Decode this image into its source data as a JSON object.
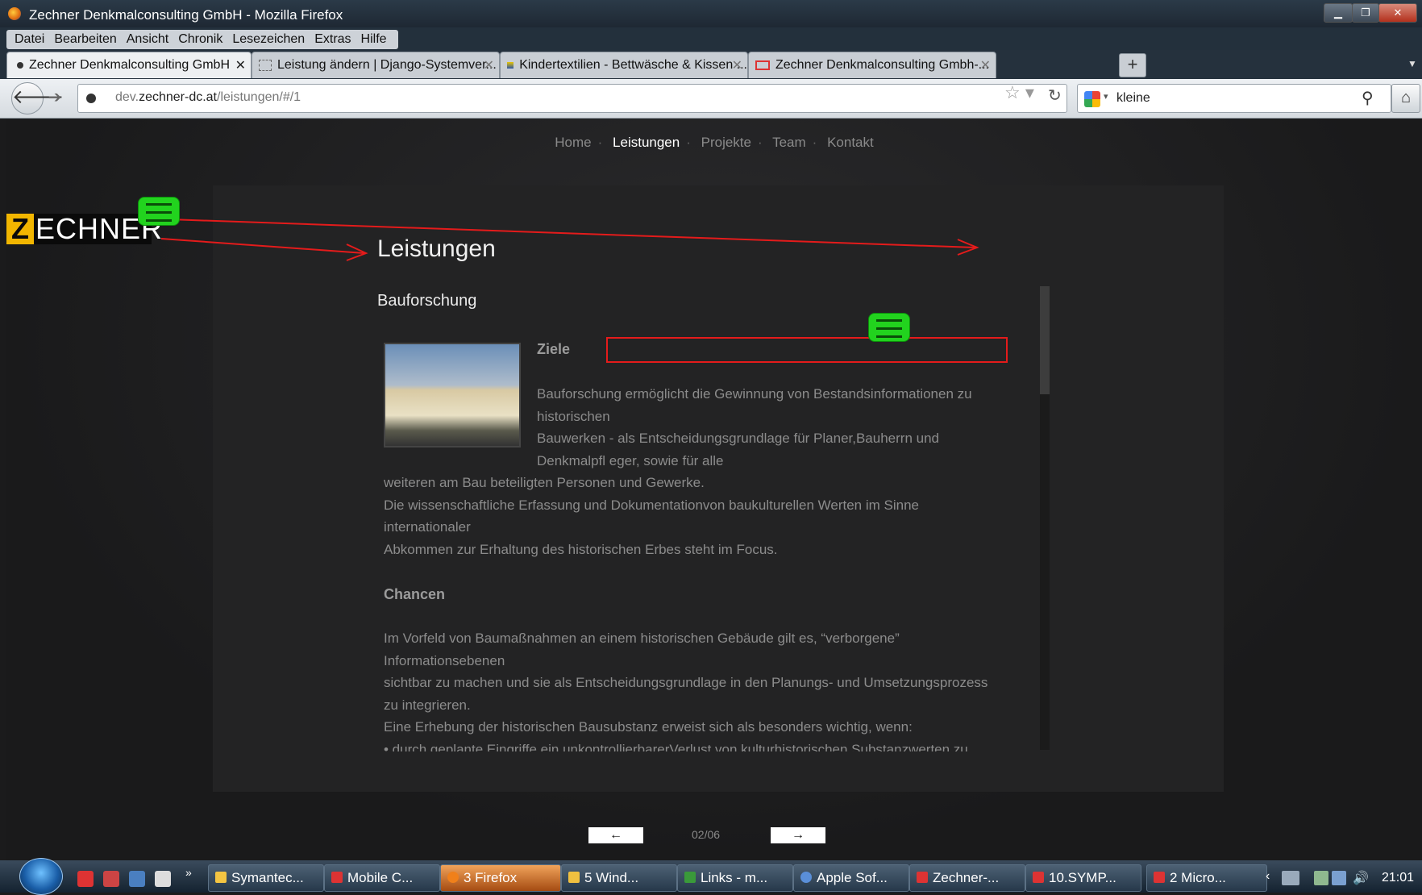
{
  "window": {
    "title": "Zechner Denkmalconsulting GmbH - Mozilla Firefox"
  },
  "menu": [
    "Datei",
    "Bearbeiten",
    "Ansicht",
    "Chronik",
    "Lesezeichen",
    "Extras",
    "Hilfe"
  ],
  "tabs": [
    {
      "label": "Zechner Denkmalconsulting GmbH",
      "active": true
    },
    {
      "label": "Leistung ändern | Django-Systemver...",
      "active": false
    },
    {
      "label": "Kindertextilien - Bettwäsche & Kissen ...",
      "active": false
    },
    {
      "label": "Zechner Denkmalconsulting Gmbh-...",
      "active": false
    }
  ],
  "url": {
    "prefix": "dev.",
    "domain": "zechner-dc.at",
    "path": "/leistungen/#/1"
  },
  "search": {
    "value": "kleine"
  },
  "site": {
    "nav": [
      "Home",
      "Leistungen",
      "Projekte",
      "Team",
      "Kontakt"
    ],
    "nav_active": "Leistungen",
    "logo": {
      "z": "Z",
      "rest": "ECHNER"
    },
    "heading": "Leistungen",
    "section": "Bauforschung",
    "ziele": "Ziele",
    "ziele_lines": [
      "Bauforschung ermöglicht die Gewinnung von Bestandsinformationen zu",
      "historischen",
      "Bauwerken - als Entscheidungsgrundlage für Planer,Bauherrn und",
      "Denkmalpfl eger, sowie für alle"
    ],
    "full_lines": [
      "weiteren am Bau beteiligten Personen und Gewerke.",
      "Die wissenschaftliche Erfassung und Dokumentationvon baukulturellen Werten im Sinne",
      "internationaler",
      "Abkommen zur Erhaltung des historischen Erbes steht im Focus."
    ],
    "chancen": "Chancen",
    "chancen_lines": [
      "Im Vorfeld von Baumaßnahmen an einem historischen Gebäude gilt es, “verborgene”",
      "Informationsebenen",
      "sichtbar zu machen und sie als Entscheidungsgrundlage in den Planungs- und Umsetzungsprozess",
      "zu integrieren.",
      "Eine Erhebung der historischen Bausubstanz erweist sich als besonders wichtig, wenn:",
      "• durch geplante Eingriffe ein unkontrollierbarerVerlust von kulturhistorischen Substanzwerten zu"
    ],
    "pager": {
      "prev": "←",
      "count": "02/06",
      "next": "→"
    }
  },
  "taskbar": {
    "items": [
      {
        "label": "Symantec...",
        "color": "#f4c542"
      },
      {
        "label": "Mobile C...",
        "color": "#d33"
      },
      {
        "label": "3 Firefox",
        "color": "#f0801a",
        "active": true
      },
      {
        "label": "5 Wind...",
        "color": "#f0c040"
      },
      {
        "label": "Links - m...",
        "color": "#3a9a3a"
      },
      {
        "label": "Apple Sof...",
        "color": "#5a8fd8"
      },
      {
        "label": "Zechner-...",
        "color": "#d33"
      },
      {
        "label": "10.SYMP...",
        "color": "#d33"
      },
      {
        "label": "2 Micro...",
        "color": "#d33"
      }
    ],
    "clock": "21:01"
  },
  "colors": {
    "accent_logo": "#f2b600",
    "annotation_red": "#e41b1b",
    "annotation_green": "#22d31e"
  }
}
